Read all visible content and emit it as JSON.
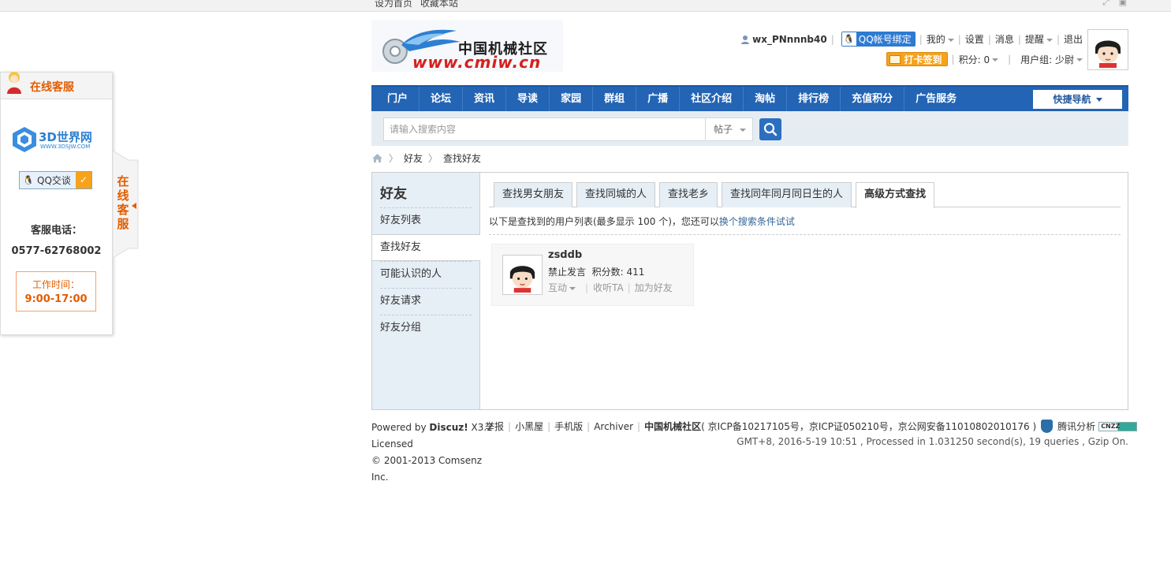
{
  "topbar": {
    "links": [
      "设为首页",
      "收藏本站"
    ]
  },
  "header": {
    "logo_cn": "中国机械社区",
    "logo_url": "www.cmiw.cn",
    "username": "wx_PNnnnb40",
    "qq_bind": "QQ帐号绑定",
    "menu": [
      "我的",
      "设置",
      "消息",
      "提醒",
      "退出"
    ],
    "checkin": "打卡签到",
    "points": "积分: 0",
    "usergroup": "用户组: 少尉"
  },
  "nav": {
    "items": [
      "门户",
      "论坛",
      "资讯",
      "导读",
      "家园",
      "群组",
      "广播",
      "社区介绍",
      "淘帖",
      "排行榜",
      "充值积分",
      "广告服务"
    ],
    "quick": "快捷导航"
  },
  "search": {
    "placeholder": "请输入搜索内容",
    "type": "帖子"
  },
  "breadcrumb": {
    "items": [
      "好友",
      "查找好友"
    ]
  },
  "sidebar": {
    "title": "好友",
    "items": [
      "好友列表",
      "查找好友",
      "可能认识的人",
      "好友请求",
      "好友分组"
    ]
  },
  "tabs": [
    "查找男女朋友",
    "查找同城的人",
    "查找老乡",
    "查找同年同月同日生的人",
    "高级方式查找"
  ],
  "notice": {
    "text": "以下是查找到的用户列表(最多显示 100 个)，您还可以",
    "link": "换个搜索条件试试"
  },
  "friend": {
    "name": "zsddb",
    "status": "禁止发言",
    "points": "积分数: 411",
    "actions": [
      "互动",
      "收听TA",
      "加为好友"
    ]
  },
  "footer": {
    "powered_prefix": "Powered by ",
    "powered_brand": "Discuz!",
    "powered_version": " X3.2",
    "licensed": "Licensed",
    "copyright": "© 2001-2013 Comsenz",
    "inc": "Inc.",
    "links": [
      "举报",
      "小黑屋",
      "手机版",
      "Archiver"
    ],
    "site_name": "中国机械社区",
    "icp": "( 京ICP备10217105号，京ICP证050210号，京公网安备11010802010176 )",
    "analytics": "腾讯分析",
    "cnzz": "CNZZ",
    "processed": "GMT+8, 2016-5-19 10:51 , Processed in 1.031250 second(s), 19 queries , Gzip On."
  },
  "service": {
    "title": "在线客服",
    "logo_text": "3D世界网",
    "logo_sub": "WWW.3DSJW.COM",
    "qq_talk": "QQ交谈",
    "phone_label": "客服电话：",
    "phone": "0577-62768002",
    "work_label": "工作时间：",
    "work_hours": "9:00-17:00",
    "handle": "在线客服"
  }
}
